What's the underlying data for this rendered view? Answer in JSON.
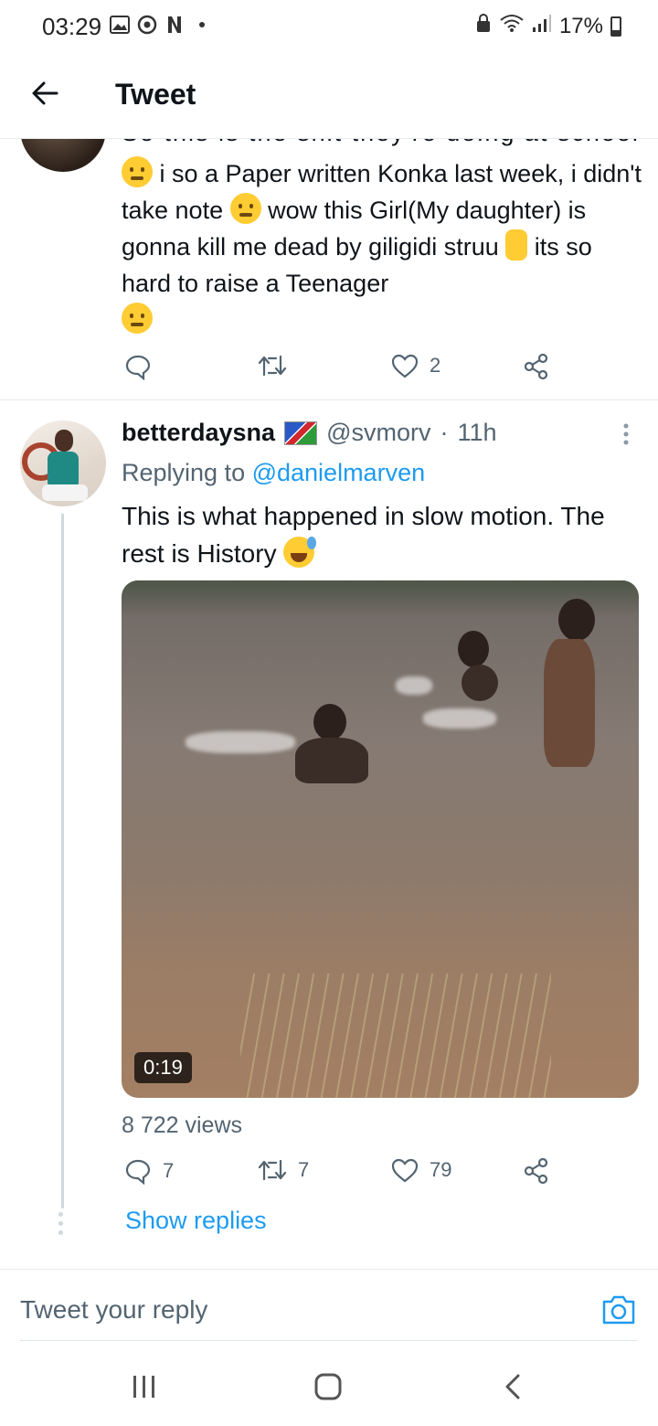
{
  "status_bar": {
    "time": "03:29",
    "battery": "17%",
    "left_icons": [
      "gallery-icon",
      "chrome-icon",
      "netflix-icon",
      "dot-icon"
    ],
    "right_icons": [
      "lock-icon",
      "wifi-icon",
      "signal-icon",
      "battery-icon"
    ]
  },
  "header": {
    "title": "Tweet"
  },
  "prev_tweet": {
    "clipped_line": "So this is the shit they're doing at school",
    "text_part1": " i so a Paper written Konka last week, i didn't take note ",
    "text_part2": " wow this Girl(My daughter) is gonna kill me dead by giligidi struu ",
    "text_part3": " its so hard to raise a Teenager",
    "actions": {
      "reply_count": "",
      "retweet_count": "",
      "like_count": "2"
    }
  },
  "reply_tweet": {
    "display_name": "betterdaysna",
    "handle": "@svmorv",
    "separator": "·",
    "time": "11h",
    "replying_prefix": "Replying to ",
    "replying_to": "@danielmarven",
    "text": "This is what happened in slow motion. The rest is History ",
    "video": {
      "duration": "0:19"
    },
    "views": "8 722 views",
    "actions": {
      "reply_count": "7",
      "retweet_count": "7",
      "like_count": "79"
    },
    "show_replies": "Show replies"
  },
  "composer": {
    "placeholder": "Tweet your reply"
  },
  "colors": {
    "accent": "#1d9bf0",
    "text_primary": "#0f1419",
    "text_secondary": "#536471",
    "divider": "#e6ecf0"
  }
}
